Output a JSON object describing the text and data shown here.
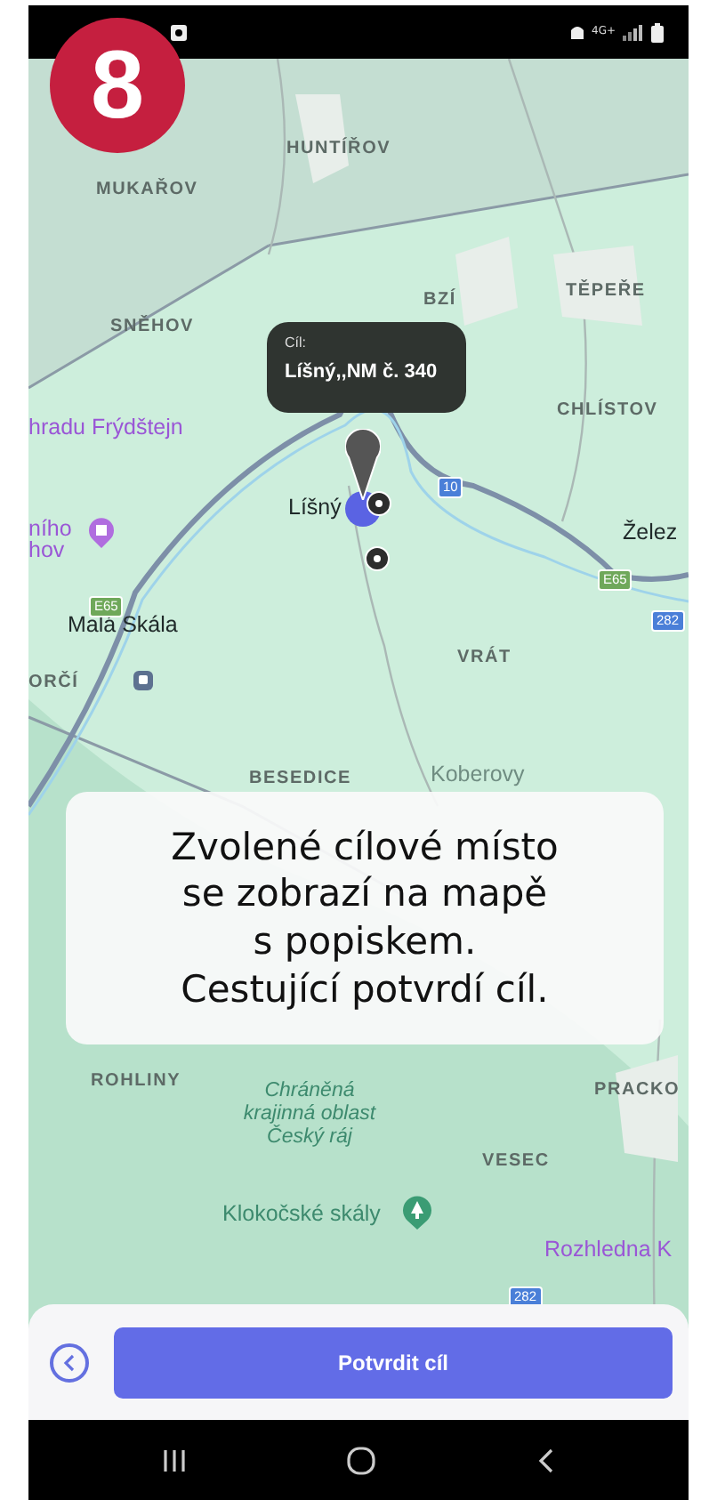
{
  "step_badge": "8",
  "status_bar": {
    "network": "4G+"
  },
  "map": {
    "labels": [
      {
        "text": "HUNTÍŘOV",
        "kind": "village"
      },
      {
        "text": "MUKAŘOV",
        "kind": "village"
      },
      {
        "text": "SNĚHOV",
        "kind": "village"
      },
      {
        "text": "BZÍ",
        "kind": "village"
      },
      {
        "text": "TĚPEŘE",
        "kind": "village"
      },
      {
        "text": "CHLÍSTOV",
        "kind": "village"
      },
      {
        "text": "hradu Frýdštejn",
        "kind": "poi"
      },
      {
        "text": "ního",
        "kind": "poi"
      },
      {
        "text": "hov",
        "kind": "poi"
      },
      {
        "text": "Líšný",
        "kind": "town"
      },
      {
        "text": "Želez",
        "kind": "town"
      },
      {
        "text": "Malá Skála",
        "kind": "town"
      },
      {
        "text": "ORČÍ",
        "kind": "village"
      },
      {
        "text": "VRÁT",
        "kind": "village"
      },
      {
        "text": "BESEDICE",
        "kind": "village"
      },
      {
        "text": "Koberovy",
        "kind": "faint"
      },
      {
        "text": "ROHLINY",
        "kind": "village"
      },
      {
        "text": "Chráněná krajinná oblast Český ráj",
        "kind": "park"
      },
      {
        "text": "PRACKO",
        "kind": "village"
      },
      {
        "text": "VESEC",
        "kind": "village"
      },
      {
        "text": "Klokočské skály",
        "kind": "nature"
      },
      {
        "text": "Rozhledna K",
        "kind": "poi"
      }
    ],
    "shields": [
      {
        "text": "10",
        "kind": "national"
      },
      {
        "text": "E65",
        "kind": "european"
      },
      {
        "text": "E65",
        "kind": "european"
      },
      {
        "text": "282",
        "kind": "national"
      },
      {
        "text": "282",
        "kind": "national"
      }
    ],
    "destination_tooltip": {
      "label": "Cíl:",
      "address": "Líšný,,NM č. 340"
    }
  },
  "caption": {
    "lines": [
      "Zvolené cílové místo",
      "se zobrazí na mapě",
      "s popiskem.",
      "Cestující potvrdí cíl."
    ]
  },
  "bottom_sheet": {
    "confirm_button": "Potvrdit cíl"
  }
}
